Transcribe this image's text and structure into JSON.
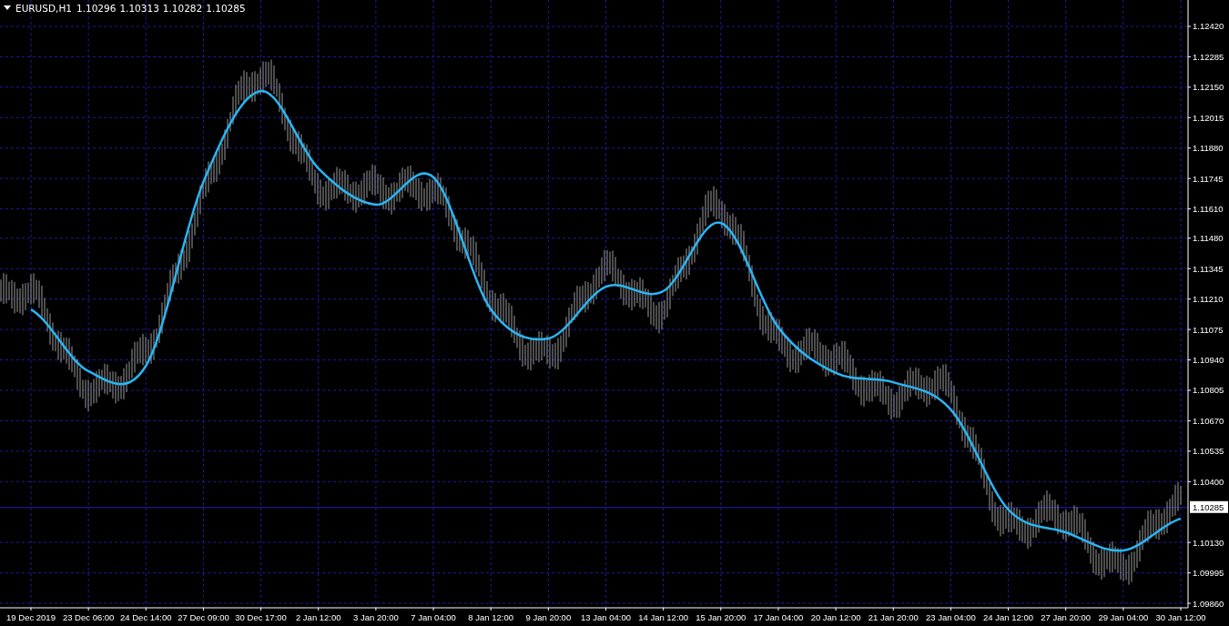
{
  "header": {
    "symbol": "EURUSD,H1",
    "quotes": [
      "1.10296",
      "1.10313",
      "1.10282",
      "1.10285"
    ]
  },
  "current_price": {
    "label": "1.10285"
  },
  "chart_data": {
    "type": "line",
    "grid": true,
    "x": [
      "19 Dec 2019",
      "23 Dec 06:00",
      "24 Dec 14:00",
      "27 Dec 09:00",
      "30 Dec 17:00",
      "2 Jan 12:00",
      "3 Jan 20:00",
      "7 Jan 04:00",
      "8 Jan 12:00",
      "9 Jan 20:00",
      "13 Jan 04:00",
      "14 Jan 12:00",
      "15 Jan 20:00",
      "17 Jan 04:00",
      "20 Jan 12:00",
      "21 Jan 20:00",
      "23 Jan 04:00",
      "24 Jan 12:00",
      "27 Jan 20:00",
      "29 Jan 04:00",
      "30 Jan 12:00"
    ],
    "series": [
      {
        "color": "#29b6f6",
        "values": [
          1.11164,
          1.1089,
          1.10914,
          1.1173,
          1.12133,
          1.1179,
          1.11629,
          1.1175,
          1.11164,
          1.11035,
          1.11265,
          1.11245,
          1.11548,
          1.11084,
          1.10882,
          1.10841,
          1.1072,
          1.10276,
          1.10175,
          1.10094,
          1.10236
        ]
      }
    ],
    "ylim": [
      1.0984,
      1.12537
    ],
    "yticks": [
      {
        "value": 1.1242,
        "label": "1.12420"
      },
      {
        "value": 1.12285,
        "label": "1.12285"
      },
      {
        "value": 1.1215,
        "label": "1.12150"
      },
      {
        "value": 1.12015,
        "label": "1.12015"
      },
      {
        "value": 1.1188,
        "label": "1.11880"
      },
      {
        "value": 1.11745,
        "label": "1.11745"
      },
      {
        "value": 1.1161,
        "label": "1.11610"
      },
      {
        "value": 1.1148,
        "label": "1.11480"
      },
      {
        "value": 1.11345,
        "label": "1.11345"
      },
      {
        "value": 1.1121,
        "label": "1.11210"
      },
      {
        "value": 1.11075,
        "label": "1.11075"
      },
      {
        "value": 1.1094,
        "label": "1.10940"
      },
      {
        "value": 1.10805,
        "label": "1.10805"
      },
      {
        "value": 1.1067,
        "label": "1.10670"
      },
      {
        "value": 1.10535,
        "label": "1.10535"
      },
      {
        "value": 1.104,
        "label": "1.10400"
      },
      {
        "value": 1.1013,
        "label": "1.10130"
      },
      {
        "value": 1.09995,
        "label": "1.09995"
      },
      {
        "value": 1.0986,
        "label": "1.09860"
      }
    ]
  }
}
